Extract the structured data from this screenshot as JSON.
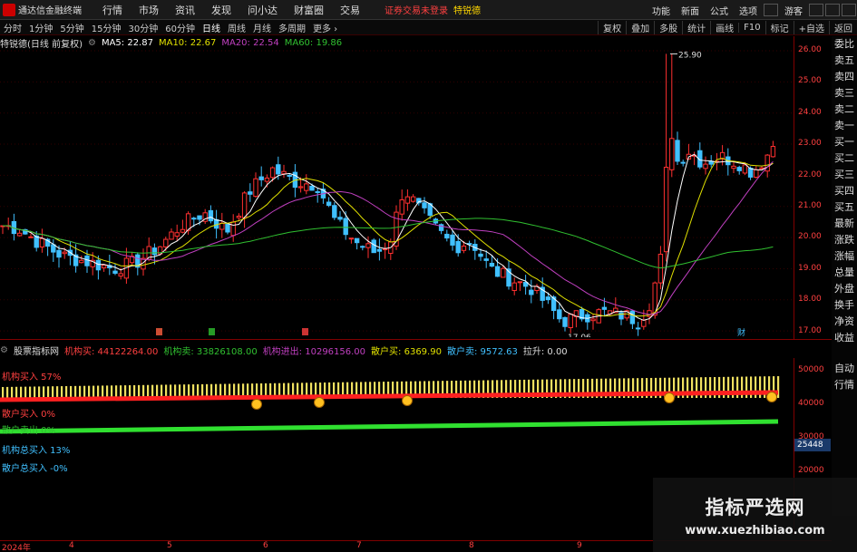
{
  "menu": {
    "app_title": "通达信金融终端",
    "items": [
      "行情",
      "市场",
      "资讯",
      "发现",
      "问小达",
      "财富圈",
      "交易"
    ],
    "notice": "证券交易未登录",
    "stock_name": "特锐德",
    "right_items": [
      "功能",
      "新面",
      "公式",
      "选项",
      "游客"
    ]
  },
  "periods": {
    "items": [
      "分时",
      "1分钟",
      "5分钟",
      "15分钟",
      "30分钟",
      "60分钟",
      "日线",
      "周线",
      "月线",
      "多周期",
      "更多 ›"
    ],
    "active": "日线",
    "right_items": [
      "复权",
      "叠加",
      "多股",
      "统计",
      "画线",
      "F10",
      "标记",
      "+自选",
      "返回"
    ]
  },
  "main_header": {
    "name": "特锐德(日线 前复权)",
    "ma5": "MA5: 22.87",
    "ma10": "MA10: 22.67",
    "ma20": "MA20: 22.54",
    "ma60": "MA60: 19.86"
  },
  "colors": {
    "ma5": "#ffffff",
    "ma10": "#e0e000",
    "ma20": "#c040c0",
    "ma60": "#30c030",
    "up": "#ff3030",
    "down": "#40c0ff"
  },
  "price_axis": [
    "26.00",
    "25.00",
    "24.00",
    "23.00",
    "22.00",
    "21.00",
    "20.00",
    "19.00",
    "18.00",
    "17.00"
  ],
  "annotations": {
    "high": "25.90",
    "low": "17.06",
    "marker_财": "财"
  },
  "sidebar": [
    "委比",
    "卖五",
    "卖四",
    "卖三",
    "卖二",
    "卖一",
    "买一",
    "买二",
    "买三",
    "买四",
    "买五",
    "最新",
    "涨跌",
    "涨幅",
    "总量",
    "外盘",
    "换手",
    "净资",
    "收益",
    "自动",
    "行情"
  ],
  "sub_header": {
    "name": "股票指标网",
    "f1": "机构买: 44122264.00",
    "f2": "机构卖: 33826108.00",
    "f3": "机构进出: 10296156.00",
    "f4": "散户买: 6369.90",
    "f5": "散户卖: 9572.63",
    "f6": "拉升: 0.00"
  },
  "sub_labels": {
    "l1": "机构买入 57%",
    "l2": "散户买入 0%",
    "l3": "散户卖出 0%",
    "l4": "机构总买入 13%",
    "l5": "散户总买入 -0%"
  },
  "sub_axis": [
    "50000",
    "40000",
    "30000",
    "20000"
  ],
  "sub_value": "25448",
  "time_axis": [
    "2024年",
    "4",
    "5",
    "6",
    "7",
    "8",
    "9"
  ],
  "watermark": {
    "title": "指标严选网",
    "url": "www.xuezhibiao.com"
  }
}
